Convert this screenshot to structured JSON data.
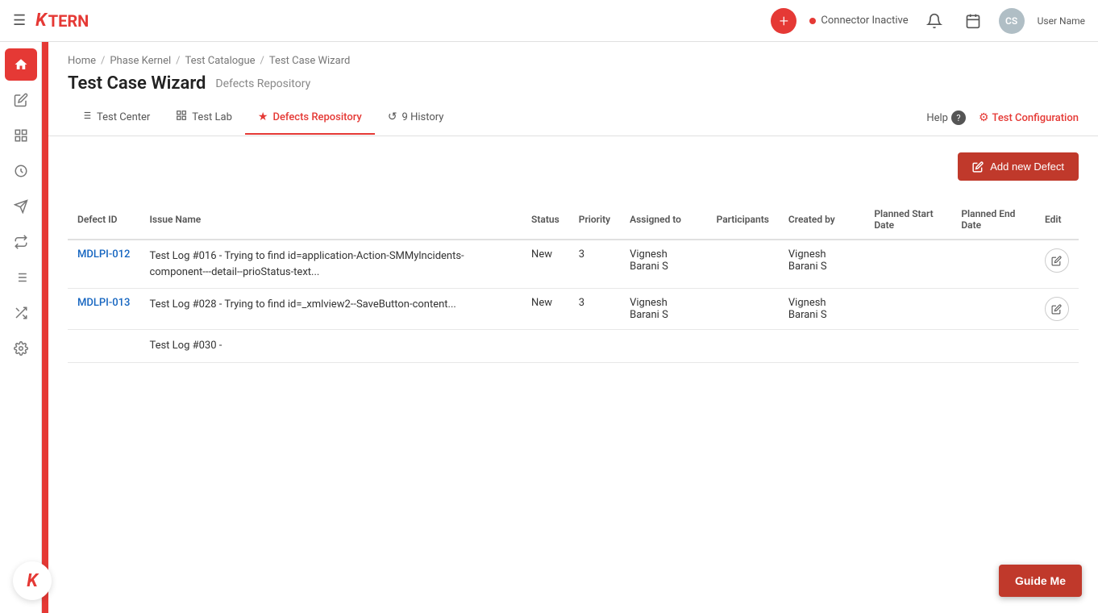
{
  "topnav": {
    "logo_text": "TERN",
    "connector_label": "Connector Inactive",
    "avatar_initials": "CS",
    "user_name": "User Name"
  },
  "breadcrumb": {
    "items": [
      "Home",
      "Phase Kernel",
      "Test Catalogue",
      "Test Case Wizard"
    ],
    "separators": [
      "/",
      "/",
      "/"
    ]
  },
  "page": {
    "title": "Test Case Wizard",
    "subtitle": "Defects Repository"
  },
  "tabs": [
    {
      "id": "test-center",
      "label": "Test Center",
      "icon": "≡",
      "active": false
    },
    {
      "id": "test-lab",
      "label": "Test Lab",
      "icon": "⊞",
      "active": false
    },
    {
      "id": "defects-repository",
      "label": "Defects Repository",
      "icon": "★",
      "active": true
    },
    {
      "id": "history",
      "label": "9 History",
      "icon": "↺",
      "active": false
    }
  ],
  "help_label": "Help",
  "test_config_label": "Test Configuration",
  "add_defect_label": "Add new Defect",
  "table": {
    "columns": [
      "Defect ID",
      "Issue Name",
      "Status",
      "Priority",
      "Assigned to",
      "Participants",
      "Created by",
      "Planned Start Date",
      "Planned End Date",
      "Edit"
    ],
    "rows": [
      {
        "id": "MDLPI-012",
        "issue_name": "Test Log #016 - Trying to find id=application-Action-SMMylncidents-component---detail--prioStatus-text...",
        "status": "New",
        "priority": "3",
        "assigned_to": "Vignesh Barani S",
        "participants": "",
        "created_by": "Vignesh Barani S",
        "planned_start": "",
        "planned_end": ""
      },
      {
        "id": "MDLPI-013",
        "issue_name": "Test Log #028 - Trying to find id=_xmlview2--SaveButton-content...",
        "status": "New",
        "priority": "3",
        "assigned_to": "Vignesh Barani S",
        "participants": "",
        "created_by": "Vignesh Barani S",
        "planned_start": "",
        "planned_end": ""
      },
      {
        "id": "",
        "issue_name": "Test Log #030 -",
        "status": "",
        "priority": "",
        "assigned_to": "",
        "participants": "",
        "created_by": "",
        "planned_start": "",
        "planned_end": ""
      }
    ]
  },
  "guide_me_label": "Guide Me",
  "sidebar_icons": [
    "≡",
    "✎",
    "⊞",
    "◎",
    "➤",
    "⇄",
    "☰",
    "✕",
    "⚙"
  ]
}
